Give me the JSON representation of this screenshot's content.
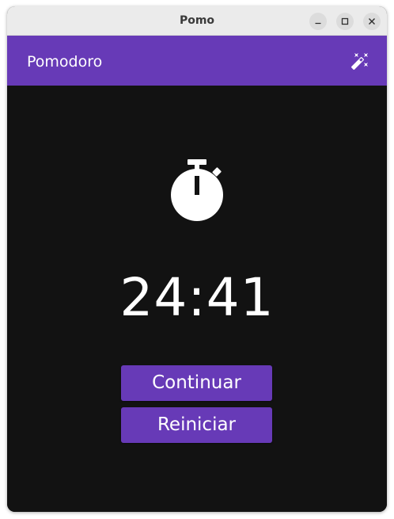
{
  "window": {
    "title": "Pomo"
  },
  "appbar": {
    "title": "Pomodoro",
    "theme_toggle_icon": "theme-toggle-icon"
  },
  "timer": {
    "icon": "stopwatch-icon",
    "display": "24:41"
  },
  "actions": {
    "continue_label": "Continuar",
    "reset_label": "Reiniciar"
  },
  "colors": {
    "primary": "#673ab7",
    "background": "#121212",
    "text": "#ffffff",
    "titlebar": "#ebebeb"
  }
}
